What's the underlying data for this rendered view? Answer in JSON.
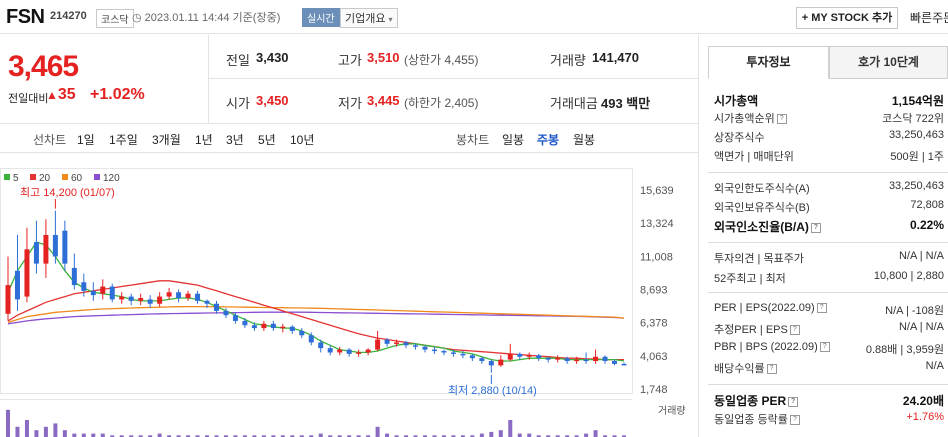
{
  "header": {
    "name": "FSN",
    "code": "214270",
    "market_tag": "코스닥",
    "timestamp": "2023.01.11 14:44 기준(장중)",
    "realtime_tag": "실시간",
    "company_info": "기업개요",
    "mystock_button": "+ MY STOCK 추가",
    "quick_order": "빠른주문"
  },
  "quote": {
    "price": "3,465",
    "change_label": "전일대비",
    "change_symbol": "▲",
    "change": "35",
    "change_pct": "+1.02%",
    "prev_close_label": "전일",
    "prev_close": "3,430",
    "high_label": "고가",
    "high": "3,510",
    "upper_limit": "(상한가 4,455)",
    "volume_label": "거래량",
    "volume": "141,470",
    "open_label": "시가",
    "open": "3,450",
    "low_label": "저가",
    "low": "3,445",
    "lower_limit": "(하한가 2,405)",
    "amount_label": "거래대금",
    "amount": "493 백만"
  },
  "period_bar": {
    "line_chart_label": "선차트",
    "line_periods": [
      "1일",
      "1주일",
      "3개월",
      "1년",
      "3년",
      "5년",
      "10년"
    ],
    "candle_label": "봉차트",
    "candle_periods": [
      "일봉",
      "주봉",
      "월봉"
    ],
    "active_candle": "주봉"
  },
  "chart_data": {
    "type": "candlestick",
    "ma_legend": [
      {
        "name": "5",
        "color": "#3bb33b"
      },
      {
        "name": "20",
        "color": "#e53333"
      },
      {
        "name": "60",
        "color": "#f08a1c"
      },
      {
        "name": "120",
        "color": "#8a4fd0"
      }
    ],
    "y_ticks": [
      "15,639",
      "13,324",
      "11,008",
      "8,693",
      "6,378",
      "4,063",
      "1,748"
    ],
    "ylim": [
      1748,
      15639
    ],
    "max_annotation": "최고 14,200 (01/07)",
    "min_annotation": "최저 2,880 (10/14)",
    "volume_label": "거래량",
    "candles": [
      [
        7000,
        9000,
        6500,
        11000,
        "up"
      ],
      [
        10000,
        8000,
        7200,
        12500,
        "down"
      ],
      [
        8200,
        11500,
        7800,
        13000,
        "up"
      ],
      [
        12000,
        10500,
        9800,
        13500,
        "down"
      ],
      [
        10500,
        12500,
        9500,
        13600,
        "up"
      ],
      [
        12500,
        11000,
        10500,
        14200,
        "down"
      ],
      [
        12800,
        10500,
        10000,
        13500,
        "down"
      ],
      [
        10200,
        9000,
        8700,
        11200,
        "down"
      ],
      [
        9200,
        8600,
        8200,
        9800,
        "down"
      ],
      [
        8600,
        8300,
        7900,
        9200,
        "down"
      ],
      [
        8400,
        8900,
        8000,
        9400,
        "up"
      ],
      [
        8900,
        8000,
        7800,
        9100,
        "down"
      ],
      [
        8000,
        8200,
        7700,
        8500,
        "up"
      ],
      [
        8200,
        7900,
        7600,
        8400,
        "down"
      ],
      [
        7900,
        8100,
        7600,
        8400,
        "up"
      ],
      [
        8000,
        7700,
        7400,
        8300,
        "down"
      ],
      [
        7700,
        8200,
        7500,
        8500,
        "up"
      ],
      [
        8200,
        8500,
        8000,
        8800,
        "up"
      ],
      [
        8500,
        8100,
        7800,
        8700,
        "down"
      ],
      [
        8100,
        8400,
        7900,
        8600,
        "up"
      ],
      [
        8400,
        7900,
        7700,
        8600,
        "down"
      ],
      [
        7900,
        7700,
        7400,
        8000,
        "down"
      ],
      [
        7700,
        7200,
        7000,
        7900,
        "down"
      ],
      [
        7200,
        6900,
        6700,
        7400,
        "down"
      ],
      [
        6900,
        6500,
        6300,
        7100,
        "down"
      ],
      [
        6500,
        6200,
        6000,
        6700,
        "down"
      ],
      [
        6200,
        6000,
        5800,
        6400,
        "down"
      ],
      [
        6000,
        6300,
        5800,
        6500,
        "up"
      ],
      [
        6300,
        6000,
        5800,
        6500,
        "down"
      ],
      [
        6000,
        6100,
        5700,
        6300,
        "up"
      ],
      [
        6100,
        5800,
        5600,
        6200,
        "down"
      ],
      [
        5800,
        5500,
        5300,
        6000,
        "down"
      ],
      [
        5500,
        5000,
        4800,
        5700,
        "down"
      ],
      [
        5000,
        4600,
        4300,
        5200,
        "down"
      ],
      [
        4600,
        4300,
        4100,
        4800,
        "down"
      ],
      [
        4300,
        4500,
        4100,
        4700,
        "up"
      ],
      [
        4500,
        4200,
        4000,
        4600,
        "down"
      ],
      [
        4200,
        4300,
        4000,
        4500,
        "up"
      ],
      [
        4300,
        4500,
        4100,
        4600,
        "up"
      ],
      [
        4500,
        5200,
        4400,
        5800,
        "up"
      ],
      [
        5200,
        4900,
        4700,
        5300,
        "down"
      ],
      [
        4900,
        5000,
        4700,
        5200,
        "up"
      ],
      [
        5000,
        4800,
        4600,
        5100,
        "down"
      ],
      [
        4800,
        4700,
        4500,
        4900,
        "down"
      ],
      [
        4700,
        4500,
        4300,
        4800,
        "down"
      ],
      [
        4500,
        4400,
        4200,
        4700,
        "down"
      ],
      [
        4400,
        4300,
        4100,
        4500,
        "down"
      ],
      [
        4300,
        4200,
        4000,
        4500,
        "down"
      ],
      [
        4200,
        4100,
        3900,
        4400,
        "down"
      ],
      [
        4100,
        3900,
        3700,
        4200,
        "down"
      ],
      [
        3900,
        3700,
        3500,
        4000,
        "down"
      ],
      [
        3700,
        3400,
        2880,
        3800,
        "down"
      ],
      [
        3400,
        3800,
        3300,
        4100,
        "up"
      ],
      [
        3800,
        4200,
        3700,
        4900,
        "up"
      ],
      [
        4200,
        4000,
        3800,
        4300,
        "down"
      ],
      [
        4000,
        4100,
        3800,
        4300,
        "up"
      ],
      [
        4100,
        3900,
        3700,
        4200,
        "down"
      ],
      [
        3900,
        3800,
        3600,
        4000,
        "down"
      ],
      [
        3800,
        3900,
        3600,
        4100,
        "up"
      ],
      [
        3900,
        3700,
        3500,
        4000,
        "down"
      ],
      [
        3700,
        3800,
        3500,
        4000,
        "up"
      ],
      [
        3800,
        3700,
        3500,
        4300,
        "down"
      ],
      [
        3700,
        4000,
        3500,
        4500,
        "up"
      ],
      [
        4000,
        3700,
        3500,
        4100,
        "down"
      ],
      [
        3700,
        3500,
        3400,
        3800,
        "down"
      ],
      [
        3500,
        3465,
        3400,
        3600,
        "down"
      ]
    ],
    "ma5": [
      8500,
      10000,
      11000,
      12000,
      11800,
      11000,
      10000,
      9200,
      8800,
      8500,
      8400,
      8300,
      8200,
      8000,
      7900,
      7900,
      7900,
      8000,
      8100,
      8100,
      8000,
      7800,
      7500,
      7200,
      6900,
      6600,
      6300,
      6200,
      6100,
      6000,
      6000,
      5800,
      5500,
      5100,
      4800,
      4500,
      4400,
      4300,
      4300,
      4400,
      4600,
      4800,
      4900,
      4900,
      4800,
      4700,
      4600,
      4400,
      4300,
      4200,
      4000,
      3800,
      3700,
      3700,
      3800,
      3900,
      3900,
      3900,
      3900,
      3800,
      3800,
      3800,
      3800,
      3800,
      3800,
      3700
    ],
    "ma20": [
      6500,
      6900,
      7200,
      7500,
      7800,
      8000,
      8200,
      8400,
      8500,
      8600,
      8700,
      8800,
      8900,
      9000,
      9100,
      9200,
      9300,
      9300,
      9200,
      9100,
      9000,
      8800,
      8600,
      8400,
      8200,
      8000,
      7800,
      7600,
      7400,
      7200,
      7000,
      6800,
      6600,
      6400,
      6200,
      6000,
      5800,
      5600,
      5450,
      5300,
      5200,
      5100,
      5000,
      4900,
      4800,
      4700,
      4600,
      4500,
      4450,
      4400,
      4350,
      4300,
      4250,
      4200,
      4150,
      4100,
      4050,
      4000,
      3950,
      3900,
      3900,
      3850,
      3850,
      3800,
      3800,
      3800
    ],
    "ma60": [
      6400,
      6600,
      6800,
      6900,
      7000,
      7100,
      7150,
      7200,
      7250,
      7300,
      7330,
      7360,
      7380,
      7400,
      7420,
      7440,
      7460,
      7480,
      7490,
      7500,
      7500,
      7500,
      7490,
      7480,
      7470,
      7460,
      7450,
      7440,
      7430,
      7420,
      7410,
      7400,
      7390,
      7380,
      7360,
      7340,
      7320,
      7300,
      7280,
      7260,
      7240,
      7220,
      7200,
      7180,
      7160,
      7140,
      7120,
      7100,
      7080,
      7060,
      7040,
      7020,
      7000,
      6980,
      6960,
      6940,
      6920,
      6900,
      6880,
      6860,
      6840,
      6820,
      6800,
      6780,
      6760,
      6700
    ],
    "ma120": [
      6300,
      6400,
      6500,
      6580,
      6650,
      6700,
      6750,
      6800,
      6830,
      6860,
      6880,
      6900,
      6920,
      6940,
      6960,
      6980,
      7000,
      7010,
      7020,
      7030,
      7040,
      7050,
      7060,
      7070,
      7080,
      7090,
      7100,
      7110,
      7110,
      7110,
      7110,
      7110,
      7100,
      7090,
      7080,
      7070,
      7060,
      7050,
      7040,
      7030,
      7020,
      7010,
      7000,
      6990,
      6980,
      6970,
      6960,
      6950,
      6940,
      6930,
      6920,
      6910,
      6900,
      6890,
      6880,
      6870,
      6860,
      6850,
      6840,
      6830,
      6820,
      6800,
      6780,
      6760,
      6740,
      6700
    ],
    "volumes": [
      0.8,
      0.3,
      0.5,
      0.2,
      0.3,
      0.4,
      0.2,
      0.1,
      0.1,
      0.1,
      0.1,
      0.05,
      0.05,
      0.05,
      0.05,
      0.05,
      0.1,
      0.05,
      0.05,
      0.05,
      0.05,
      0.05,
      0.05,
      0.05,
      0.05,
      0.05,
      0.05,
      0.05,
      0.05,
      0.05,
      0.05,
      0.05,
      0.05,
      0.1,
      0.05,
      0.05,
      0.05,
      0.05,
      0.05,
      0.3,
      0.1,
      0.05,
      0.05,
      0.05,
      0.05,
      0.05,
      0.05,
      0.05,
      0.05,
      0.05,
      0.1,
      0.15,
      0.2,
      0.5,
      0.1,
      0.1,
      0.05,
      0.05,
      0.05,
      0.05,
      0.05,
      0.1,
      0.2,
      0.05,
      0.05,
      0.05
    ]
  },
  "sidebar": {
    "tabs": [
      "투자정보",
      "호가 10단계"
    ],
    "active_tab": "투자정보",
    "rows": [
      {
        "k": "시가총액",
        "v": "1,154억원",
        "bold": true
      },
      {
        "k": "시가총액순위",
        "v": "코스닥 722위",
        "help": true
      },
      {
        "k": "상장주식수",
        "v": "33,250,463"
      },
      {
        "k": "액면가 | 매매단위",
        "v": "500원 | 1주"
      },
      {
        "k": "외국인한도주식수(A)",
        "v": "33,250,463"
      },
      {
        "k": "외국인보유주식수(B)",
        "v": "72,808"
      },
      {
        "k": "외국인소진율(B/A)",
        "v": "0.22%",
        "bold": true,
        "help": true
      },
      {
        "k": "투자의견 | 목표주가",
        "v": "N/A | N/A"
      },
      {
        "k": "52주최고 | 최저",
        "v": "10,800 | 2,880"
      },
      {
        "k": "PER | EPS(2022.09)",
        "v": "N/A | -108원",
        "help": true
      },
      {
        "k": "추정PER | EPS",
        "v": "N/A | N/A",
        "help": true
      },
      {
        "k": "PBR | BPS (2022.09)",
        "v": "0.88배 | 3,959원",
        "help": true
      },
      {
        "k": "배당수익률",
        "v": "N/A",
        "help": true
      },
      {
        "k": "동일업종 PER",
        "v": "24.20배",
        "bold": true,
        "help": true
      },
      {
        "k": "동일업종 등락률",
        "v": "+1.76%",
        "red": true,
        "help": true
      }
    ]
  }
}
